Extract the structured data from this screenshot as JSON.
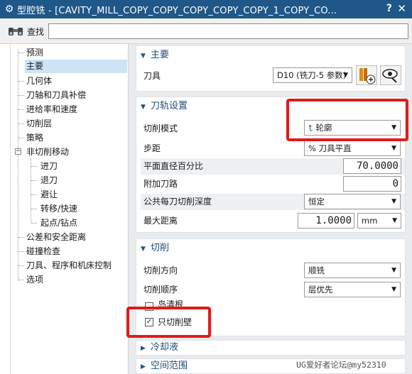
{
  "window": {
    "title": "型腔铣 - [CAVITY_MILL_COPY_COPY_COPY_COPY_COPY_1_COPY_CO...",
    "help_label": "?",
    "close_label": "✕"
  },
  "search": {
    "label": "查找",
    "value": ""
  },
  "tree": {
    "items": [
      {
        "label": "预测"
      },
      {
        "label": "主要"
      },
      {
        "label": "几何体"
      },
      {
        "label": "刀轴和刀具补偿"
      },
      {
        "label": "进给率和速度"
      },
      {
        "label": "切削层"
      },
      {
        "label": "策略"
      },
      {
        "label": "非切削移动"
      },
      {
        "label": "进刀"
      },
      {
        "label": "退刀"
      },
      {
        "label": "避让"
      },
      {
        "label": "转移/快速"
      },
      {
        "label": "起点/钻点"
      },
      {
        "label": "公差和安全距离"
      },
      {
        "label": "碰撞检查"
      },
      {
        "label": "刀具、程序和机床控制"
      },
      {
        "label": "选项"
      }
    ],
    "selected_index": 1
  },
  "main_group": {
    "header": "主要",
    "tool_label": "刀具",
    "tool_value": "D10 (铣刀-5 参数)"
  },
  "toolpath_group": {
    "header": "刀轨设置",
    "cut_pattern_label": "切削模式",
    "cut_pattern_value": "轮廓",
    "stepover_label": "步距",
    "stepover_value": "% 刀具平直",
    "percent_diam_label": "平面直径百分比",
    "percent_diam_value": "70.0000",
    "additional_passes_label": "附加刀路",
    "additional_passes_value": "0",
    "depth_per_cut_label": "公共每刀切削深度",
    "depth_per_cut_value": "恒定",
    "max_distance_label": "最大距离",
    "max_distance_value": "1.0000",
    "max_distance_unit": "mm"
  },
  "cutting_group": {
    "header": "切削",
    "direction_label": "切削方向",
    "direction_value": "顺铣",
    "order_label": "切削顺序",
    "order_value": "层优先",
    "island_cleanup_label": "岛清根",
    "wall_only_label": "只切削壁",
    "wall_only_checked": true
  },
  "coolant_group": {
    "header": "冷却液"
  },
  "space_group": {
    "header": "空间范围"
  },
  "watermark": "UG爱好者论坛@my52310",
  "colors": {
    "titlebar": "#1f5788",
    "highlight_box": "#e11b1b",
    "selected_item": "#cde4f7"
  }
}
